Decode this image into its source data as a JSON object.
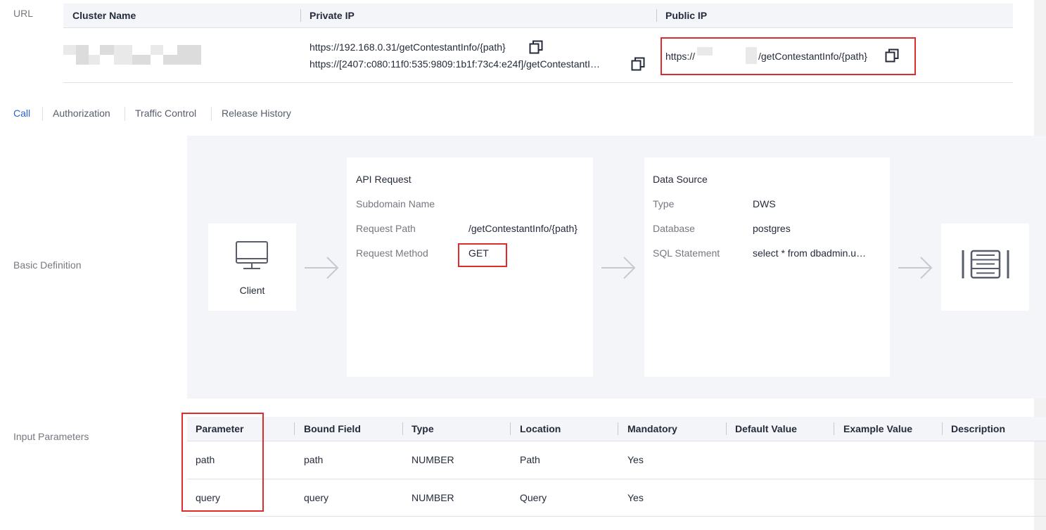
{
  "url_section": {
    "label": "URL",
    "headers": {
      "cluster_name": "Cluster Name",
      "private_ip": "Private IP",
      "public_ip": "Public IP"
    },
    "row": {
      "private_ip_1": "https://192.168.0.31/getContestantInfo/{path}",
      "private_ip_2": "https://[2407:c080:11f0:535:9809:1b1f:73c4:e24f]/getContestantI…",
      "public_ip_prefix": "https://",
      "public_ip_suffix": "/getContestantInfo/{path}"
    }
  },
  "tabs": [
    "Call",
    "Authorization",
    "Traffic Control",
    "Release History"
  ],
  "basic_definition": {
    "label": "Basic Definition",
    "client": {
      "label": "Client",
      "icon": "monitor-icon"
    },
    "api_request": {
      "title": "API Request",
      "subdomain_label": "Subdomain Name",
      "subdomain_value": "",
      "path_label": "Request Path",
      "path_value": "/getContestantInfo/{path}",
      "method_label": "Request Method",
      "method_value": "GET"
    },
    "data_source": {
      "title": "Data Source",
      "type_label": "Type",
      "type_value": "DWS",
      "database_label": "Database",
      "database_value": "postgres",
      "sql_label": "SQL Statement",
      "sql_value": "select * from dbadmin.u…"
    },
    "target_icon": "database-server-icon"
  },
  "input_parameters": {
    "label": "Input Parameters",
    "headers": [
      "Parameter",
      "Bound Field",
      "Type",
      "Location",
      "Mandatory",
      "Default Value",
      "Example Value",
      "Description"
    ],
    "rows": [
      [
        "path",
        "path",
        "NUMBER",
        "Path",
        "Yes",
        "",
        "",
        ""
      ],
      [
        "query",
        "query",
        "NUMBER",
        "Query",
        "Yes",
        "",
        "",
        ""
      ]
    ]
  },
  "colors": {
    "accent": "#2f5fd0",
    "highlight_border": "#e02b2b",
    "panel_bg": "#f3f5f9"
  }
}
